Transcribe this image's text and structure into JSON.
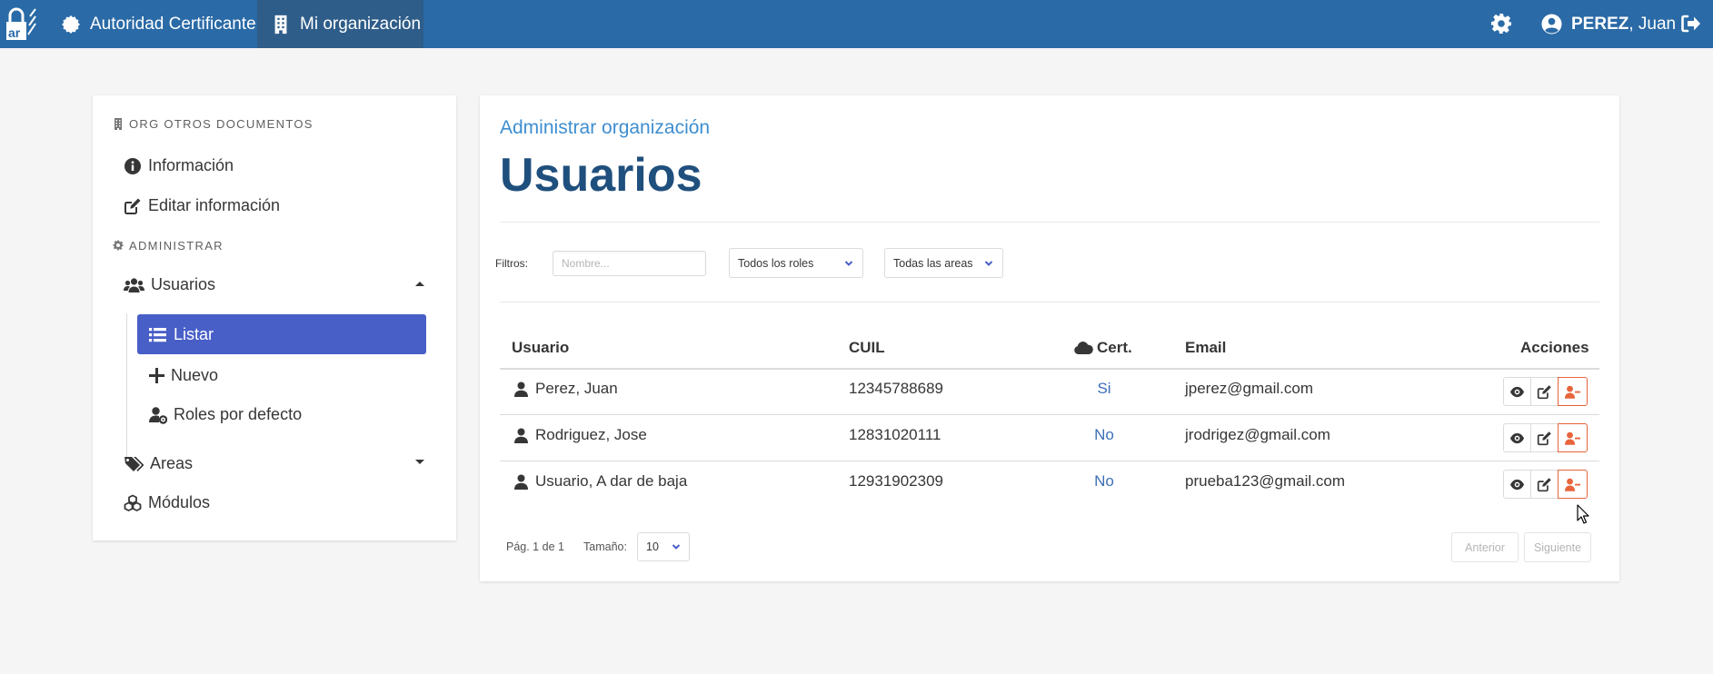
{
  "navbar": {
    "brand_icon": "ar-lock-logo",
    "items": [
      {
        "label": "Autoridad Certificante",
        "icon": "certificate-icon"
      },
      {
        "label": "Mi organización",
        "icon": "building-icon"
      }
    ],
    "user": {
      "last_name": "PEREZ",
      "first_name": ", Juan"
    },
    "colors": {
      "bar": "#2a6aa6",
      "active": "#2f5d89"
    }
  },
  "sidebar": {
    "org_label": "ORG OTROS DOCUMENTOS",
    "info_label": "Información",
    "edit_label": "Editar información",
    "admin_label": "ADMINISTRAR",
    "users_label": "Usuarios",
    "submenu": {
      "list_label": "Listar",
      "new_label": "Nuevo",
      "roles_label": "Roles por defecto"
    },
    "areas_label": "Areas",
    "modules_label": "Módulos",
    "active_color": "#485fc7"
  },
  "main": {
    "subtitle": "Administrar organización",
    "title": "Usuarios",
    "filters": {
      "label": "Filtros:",
      "name_placeholder": "Nombre...",
      "roles_value": "Todos los roles",
      "areas_value": "Todas las areas"
    },
    "table": {
      "headers": {
        "user": "Usuario",
        "cuil": "CUIL",
        "cert": "Cert.",
        "email": "Email",
        "actions": "Acciones"
      },
      "rows": [
        {
          "name": "Perez, Juan",
          "cuil": "12345788689",
          "cert": "Si",
          "email": "jperez@gmail.com"
        },
        {
          "name": "Rodriguez, Jose",
          "cuil": "12831020111",
          "cert": "No",
          "email": "jrodrigez@gmail.com"
        },
        {
          "name": "Usuario, A dar de baja",
          "cuil": "12931902309",
          "cert": "No",
          "email": "prueba123@gmail.com"
        }
      ]
    },
    "pagination": {
      "page_text": "Pág. 1 de 1",
      "size_label": "Tamaño:",
      "size_value": "10",
      "prev_label": "Anterior",
      "next_label": "Siguiente"
    }
  }
}
